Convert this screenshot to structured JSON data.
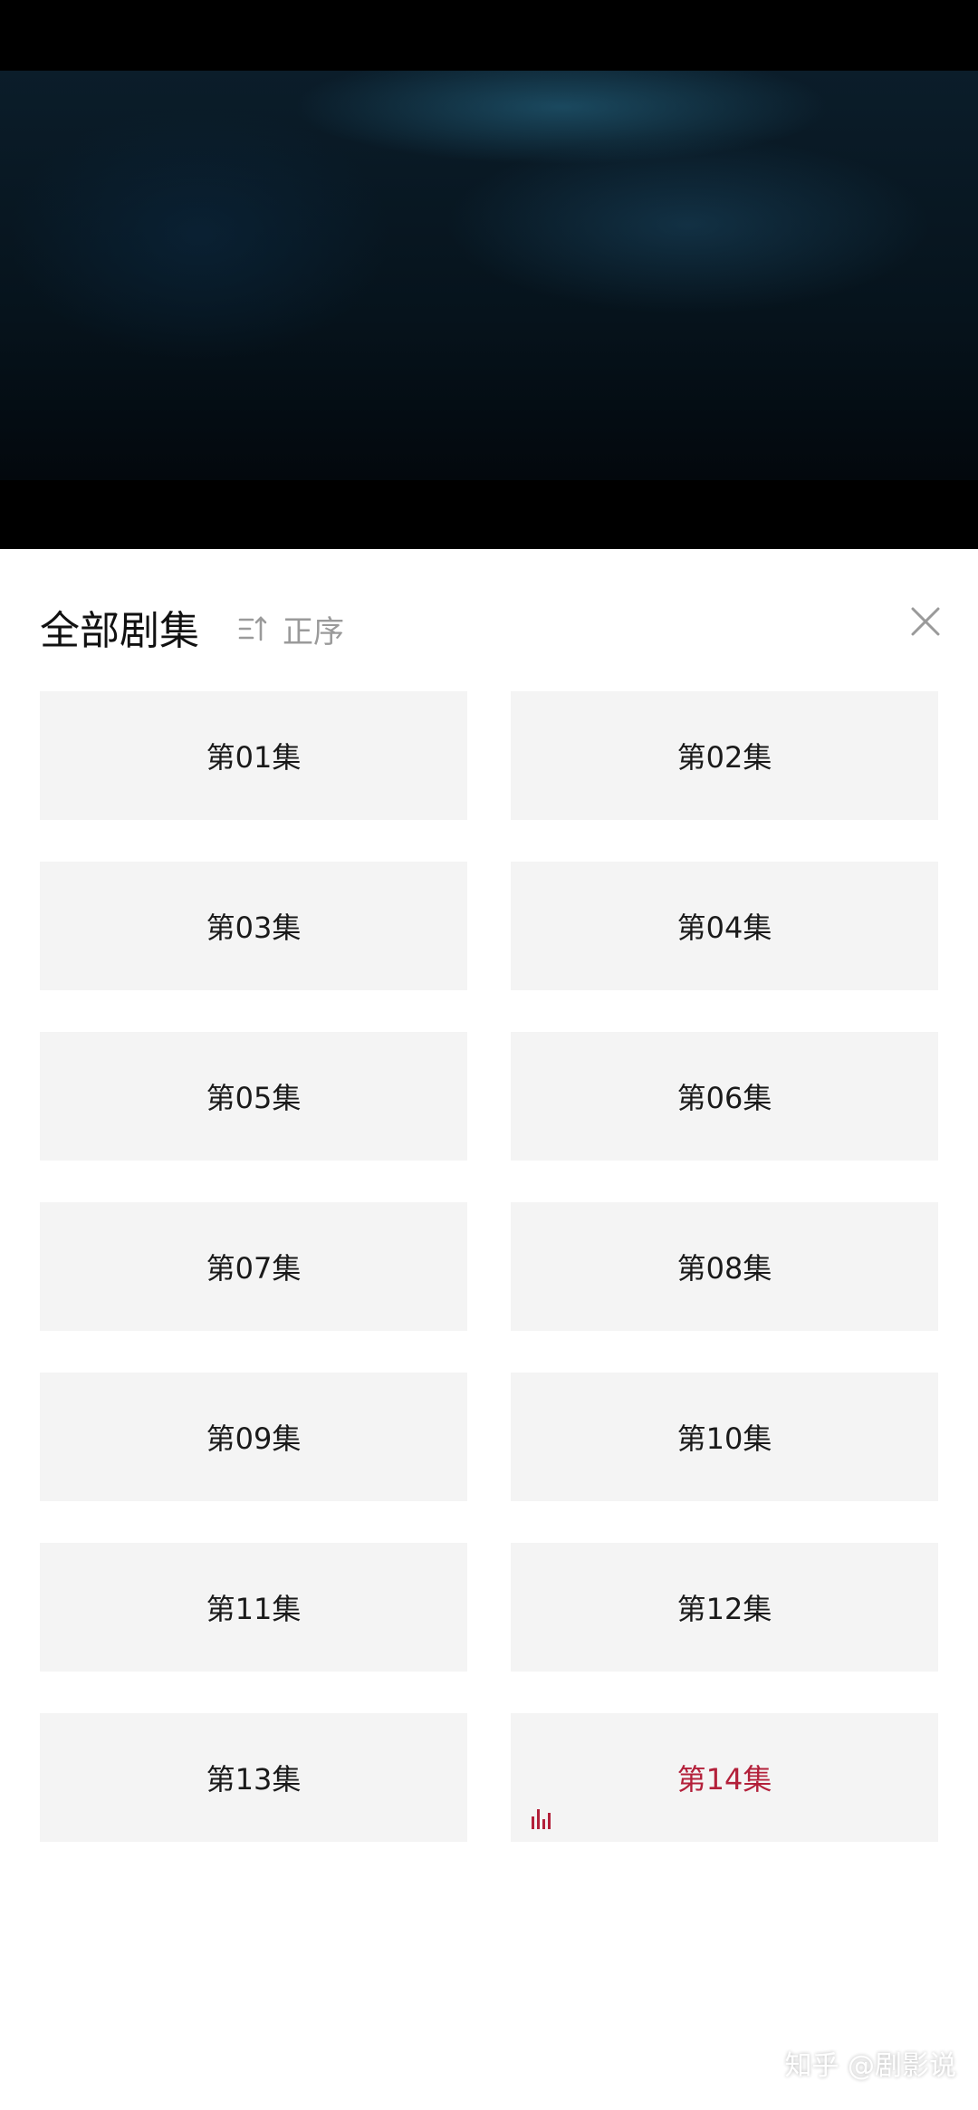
{
  "panel": {
    "title": "全部剧集",
    "sort_label": "正序"
  },
  "episodes": [
    {
      "label": "第01集"
    },
    {
      "label": "第02集"
    },
    {
      "label": "第03集"
    },
    {
      "label": "第04集"
    },
    {
      "label": "第05集"
    },
    {
      "label": "第06集"
    },
    {
      "label": "第07集"
    },
    {
      "label": "第08集"
    },
    {
      "label": "第09集"
    },
    {
      "label": "第10集"
    },
    {
      "label": "第11集"
    },
    {
      "label": "第12集"
    },
    {
      "label": "第13集"
    },
    {
      "label": "第14集"
    }
  ],
  "current_episode": "第14集",
  "colors": {
    "accent": "#b3203a",
    "tile_background": "#f4f4f4",
    "secondary_text": "#9a9a9a"
  },
  "icons": {
    "sort": "sort-icon",
    "close": "close-icon",
    "playing": "equalizer-icon"
  },
  "watermark": "知乎 @剧影说"
}
